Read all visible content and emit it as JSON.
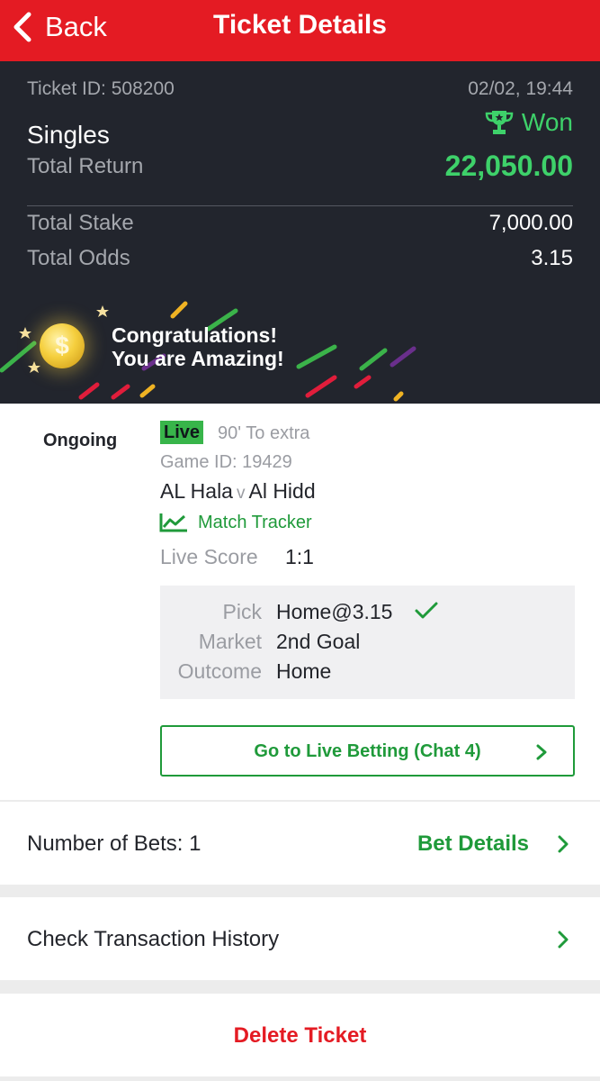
{
  "header": {
    "back_label": "Back",
    "title": "Ticket Details"
  },
  "summary": {
    "ticket_id": "Ticket ID: 508200",
    "datetime": "02/02, 19:44",
    "status": "Won",
    "bet_type": "Singles",
    "total_return_label": "Total Return",
    "total_return_value": "22,050.00",
    "total_stake_label": "Total Stake",
    "total_stake_value": "7,000.00",
    "total_odds_label": "Total Odds",
    "total_odds_value": "3.15",
    "banner_line1": "Congratulations!",
    "banner_line2": "You are Amazing!"
  },
  "bet": {
    "state": "Ongoing",
    "live_badge": "Live",
    "live_status": "90' To extra",
    "game_id": "Game ID: 19429",
    "home_team": "AL Hala",
    "vs": "v",
    "away_team": "Al Hidd",
    "tracker_label": "Match Tracker",
    "score_label": "Live Score",
    "score_value": "1:1",
    "pick_label": "Pick",
    "pick_value": "Home@3.15",
    "market_label": "Market",
    "market_value": "2nd Goal",
    "outcome_label": "Outcome",
    "outcome_value": "Home",
    "live_betting_button": "Go to Live Betting (Chat 4)"
  },
  "rows": {
    "bets_count": "Number of Bets: 1",
    "bet_details": "Bet Details",
    "transaction_history": "Check Transaction History",
    "delete_ticket": "Delete Ticket"
  },
  "colors": {
    "header_red": "#e41b23",
    "summary_bg": "#22252d",
    "won_green": "#3ed16a",
    "accent_green": "#1f9a3a"
  },
  "icons": {
    "back": "chevron-left-icon",
    "won": "trophy-icon",
    "coin": "dollar-coin-icon",
    "tracker": "line-chart-icon",
    "pick_result": "checkmark-icon",
    "row_arrow": "chevron-right-icon"
  }
}
